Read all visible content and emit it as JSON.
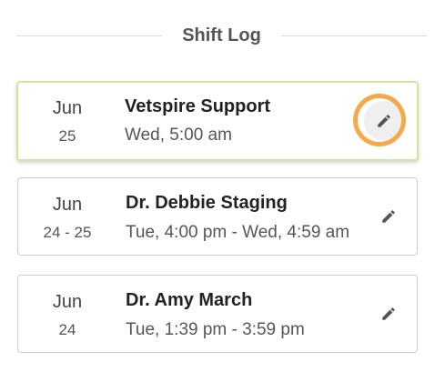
{
  "header": {
    "title": "Shift Log"
  },
  "shifts": [
    {
      "month": "Jun",
      "day": "25",
      "name": "Vetspire Support",
      "time": "Wed, 5:00 am",
      "edit_icon": "pencil-icon"
    },
    {
      "month": "Jun",
      "day": "24 - 25",
      "name": "Dr. Debbie Staging",
      "time": "Tue, 4:00 pm - Wed, 4:59 am",
      "edit_icon": "pencil-icon"
    },
    {
      "month": "Jun",
      "day": "24",
      "name": "Dr. Amy March",
      "time": "Tue, 1:39 pm - 3:59 pm",
      "edit_icon": "pencil-icon"
    }
  ],
  "colors": {
    "highlight_border": "#cde79b",
    "focus_ring": "#f6a94a",
    "card_border": "#cfcfcf"
  }
}
